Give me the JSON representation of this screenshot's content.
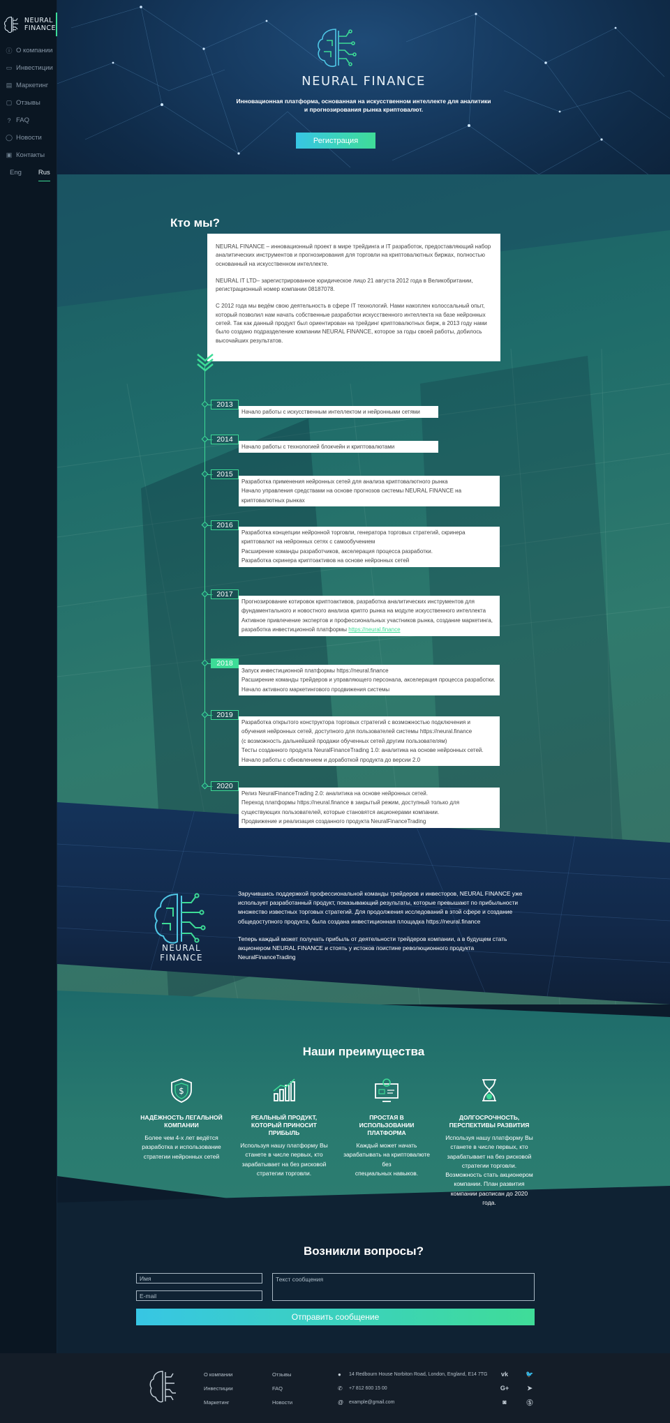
{
  "brand": {
    "name_line1": "NEURAL",
    "name_line2": "FINANCE",
    "full": "NEURAL FINANCE"
  },
  "sidebar": {
    "items": [
      {
        "label": "О компании",
        "icon": "info-icon"
      },
      {
        "label": "Инвестиции",
        "icon": "wallet-icon"
      },
      {
        "label": "Маркетинг",
        "icon": "chart-icon"
      },
      {
        "label": "Отзывы",
        "icon": "chat-icon"
      },
      {
        "label": "FAQ",
        "icon": "question-icon"
      },
      {
        "label": "Новости",
        "icon": "globe-icon"
      },
      {
        "label": "Контакты",
        "icon": "contacts-icon"
      }
    ],
    "lang": {
      "eng": "Eng",
      "rus": "Rus",
      "active": "Rus"
    }
  },
  "hero": {
    "title": "NEURAL FINANCE",
    "subtitle_line1": "Инновационная платформа, основанная на искусственном интеллекте для аналитики",
    "subtitle_line2": "и прогнозирования рынка криптовалют.",
    "button": "Регистрация"
  },
  "about": {
    "heading": "Кто мы?",
    "p1": "NEURAL FINANCE – инновационный проект в мире трейдинга и IT разработок, предоставляющий набор аналитических инструментов и прогнозирования для торговли на криптовалютных биржах, полностью основанный на искусственном интеллекте.",
    "p2": "NEURAL IT LTD– зарегистрированное юридическое лицо 21 августа 2012 года в Великобритании, регистрационный номер компании 08187078.",
    "p3": "С 2012 года мы ведём свою деятельность в сфере IT технологий. Нами накоплен колоссальный опыт, который позволил нам начать собственные разработки искусственного интеллекта на базе нейронных сетей. Так как данный продукт был ориентирован на трейдинг криптовалютных бирж, в 2013 году нами было создано подразделение компании NEURAL FINANCE, которое за годы своей работы, добилось высочайших результатов."
  },
  "timeline": [
    {
      "year": "2013",
      "lines": [
        "Начало работы с искусственным интеллектом и нейронными сетями"
      ]
    },
    {
      "year": "2014",
      "lines": [
        "Начало работы с технологией блокчейн и криптовалютами"
      ]
    },
    {
      "year": "2015",
      "lines": [
        "Разработка применения нейронных сетей для анализа криптовалютного рынка",
        "Начало управления средствами на основе прогнозов системы NEURAL FINANCE на",
        "криптовалютных рынках"
      ]
    },
    {
      "year": "2016",
      "lines": [
        "Разработка концепции нейронной торговли, генератора торговых стратегий, скринера",
        "криптовалют на нейронных сетях с самообучением",
        "Расширение команды разработчиков, акселерация процесса разработки.",
        "Разработка скринера криптоактивов на основе нейронных сетей"
      ]
    },
    {
      "year": "2017",
      "lines": [
        "Прогнозирование котировок криптоактивов, разработка аналитических инструментов для",
        "фундаментального и новостного анализа крипто рынка на модуле искусственного интеллекта",
        "Активное привлечение экспертов и профессиональных участников рынка, создание маркетинга,",
        "разработка инвестиционной платформы"
      ],
      "link": "https://neural.finance"
    },
    {
      "year": "2018",
      "lines": [
        "Запуск инвестиционной платформы https://neural.finance",
        "Расширение команды трейдеров и управляющего персонала, акселерация процесса разработки.",
        "Начало активного маркетингового продвижения системы"
      ]
    },
    {
      "year": "2019",
      "lines": [
        "Разработка открытого конструктора торговых стратегий с возможностью подключения и",
        "обучения нейронных сетей, доступного для пользователей системы https://neural.finance",
        "(с возможность дальнейшей продажи обученных сетей другим пользователям)",
        "Тесты созданного продукта NeuralFinanceTrading 1.0: аналитика на основе нейронных сетей.",
        "Начало работы с обновлением и доработкой продукта до версии 2.0"
      ]
    },
    {
      "year": "2020",
      "lines": [
        "Релиз NeuralFinanceTrading 2.0: аналитика на основе нейронных сетей.",
        "Переход платформы https://neural.finance в закрытый режим, доступный только для",
        "существующих пользователей, которые становятся акционерами компании.",
        "Продвижение и реализация созданного продукта NeuralFinanceTrading"
      ]
    }
  ],
  "band": {
    "logo_text": "NEURAL FINANCE",
    "p1": "Заручившись поддержкой профессиональной команды трейдеров и инвесторов, NEURAL FINANCE уже использует разработанный продукт, показывающий результаты, которые превышают по прибыльности множество известных торговых стратегий. Для продолжения исследований в этой сфере и создание общедоступного продукта, была создана инвестиционная площадка https://neural.finance",
    "p2": "Теперь каждый может получать прибыль от деятельности трейдеров компании, а в будущем стать акционером NEURAL FINANCE и стоять у истоков поистине революционного продукта NeuralFinanceTrading"
  },
  "advantages": {
    "heading": "Наши преимущества",
    "items": [
      {
        "icon": "shield-dollar-icon",
        "title1": "НАДЁЖНОСТЬ ЛЕГАЛЬНОЙ",
        "title2": "КОМПАНИИ",
        "desc": [
          "Более чем 4-х лет ведётся",
          "разработка и использование",
          "стратегии нейронных сетей"
        ]
      },
      {
        "icon": "growth-chart-icon",
        "title1": "РЕАЛЬНЫЙ ПРОДУКТ,",
        "title2": "КОТОРЫЙ ПРИНОСИТ ПРИБЫЛЬ",
        "desc": [
          "Используя нашу платформу Вы",
          "станете в числе первых, кто",
          "зарабатывает на без рисковой",
          "стратегии торговли."
        ]
      },
      {
        "icon": "monitor-gear-icon",
        "title1": "ПРОСТАЯ В ИСПОЛЬЗОВАНИИ",
        "title2": "ПЛАТФОРМА",
        "desc": [
          "Каждый может начать",
          "зарабатывать на криптовалюте без",
          "специальных навыков."
        ]
      },
      {
        "icon": "hourglass-icon",
        "title1": "ДОЛГОСРОЧНОСТЬ,",
        "title2": "ПЕРСПЕКТИВЫ РАЗВИТИЯ",
        "desc": [
          "Используя нашу платформу Вы",
          "станете в числе первых, кто",
          "зарабатывает на без рисковой",
          "стратегии торговли.",
          "Возможность стать акционером",
          "компании. План развития",
          "компании расписан до 2020 года."
        ]
      }
    ]
  },
  "contact": {
    "heading": "Возникли вопросы?",
    "name_placeholder": "Имя",
    "email_placeholder": "E-mail",
    "message_placeholder": "Текст сообщения",
    "send": "Отправить сообщение"
  },
  "footer": {
    "col1": [
      "О компании",
      "Инвестиции",
      "Маркетинг"
    ],
    "col2": [
      "Отзывы",
      "FAQ",
      "Новости"
    ],
    "address": "14 Redbourn House Norbiton Road, London, England, E14 7TG",
    "phone": "+7 812 600 15 00",
    "email": "example@gmail.com",
    "social": [
      "VK",
      "twitter",
      "G+",
      "telegram",
      "instagram",
      "skype"
    ]
  },
  "colors": {
    "accent": "#3ddc97",
    "accent2": "#37c6e4",
    "sidebar": "#0a1622",
    "footer": "#141d28"
  }
}
